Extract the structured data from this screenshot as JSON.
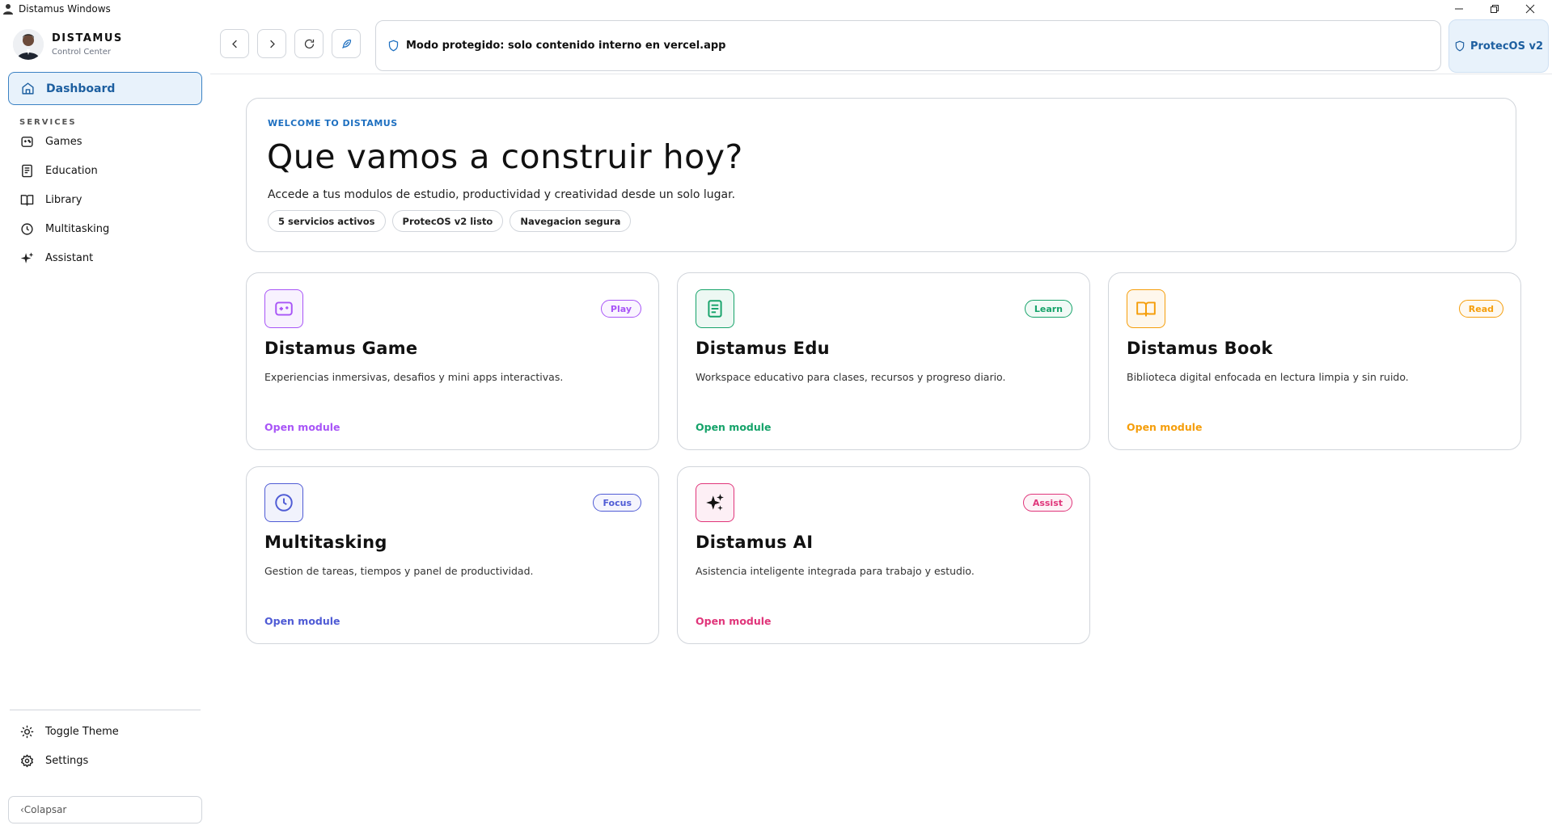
{
  "window": {
    "title": "Distamus Windows"
  },
  "brand": {
    "name": "DISTAMUS",
    "subtitle": "Control Center"
  },
  "sidebar": {
    "active": {
      "label": "Dashboard",
      "icon": "home-icon"
    },
    "section_label": "SERVICES",
    "items": [
      {
        "label": "Games",
        "icon": "gamepad-icon"
      },
      {
        "label": "Education",
        "icon": "notebook-icon"
      },
      {
        "label": "Library",
        "icon": "book-icon"
      },
      {
        "label": "Multitasking",
        "icon": "clock-icon"
      },
      {
        "label": "Assistant",
        "icon": "sparkles-icon"
      }
    ],
    "bottom": [
      {
        "label": "Toggle Theme",
        "icon": "sun-icon"
      },
      {
        "label": "Settings",
        "icon": "gear-icon"
      }
    ],
    "collapse_label": "‹Colapsar"
  },
  "toolbar": {
    "address_text": "Modo protegido: solo contenido interno en vercel.app",
    "protec_label": "ProtecOS v2"
  },
  "hero": {
    "eyebrow": "WELCOME TO DISTAMUS",
    "title": "Que vamos a construir hoy?",
    "subtitle": "Accede a tus modulos de estudio, productividad y creatividad desde un solo lugar.",
    "chips": [
      "5 servicios activos",
      "ProtecOS v2 listo",
      "Navegacion segura"
    ]
  },
  "cards": [
    {
      "title": "Distamus Game",
      "badge": "Play",
      "desc": "Experiencias inmersivas, desafios y mini apps interactivas.",
      "link": "Open module",
      "color": "#a855f7",
      "icon": "gamepad-icon"
    },
    {
      "title": "Distamus Edu",
      "badge": "Learn",
      "desc": "Workspace educativo para clases, recursos y progreso diario.",
      "link": "Open module",
      "color": "#16a36a",
      "icon": "notebook-icon"
    },
    {
      "title": "Distamus Book",
      "badge": "Read",
      "desc": "Biblioteca digital enfocada en lectura limpia y sin ruido.",
      "link": "Open module",
      "color": "#f59e0b",
      "icon": "book-icon"
    },
    {
      "title": "Multitasking",
      "badge": "Focus",
      "desc": "Gestion de tareas, tiempos y panel de productividad.",
      "link": "Open module",
      "color": "#4f5bd5",
      "icon": "clock-icon"
    },
    {
      "title": "Distamus AI",
      "badge": "Assist",
      "desc": "Asistencia inteligente integrada para trabajo y estudio.",
      "link": "Open module",
      "color": "#e0357a",
      "icon": "sparkles-icon"
    }
  ]
}
